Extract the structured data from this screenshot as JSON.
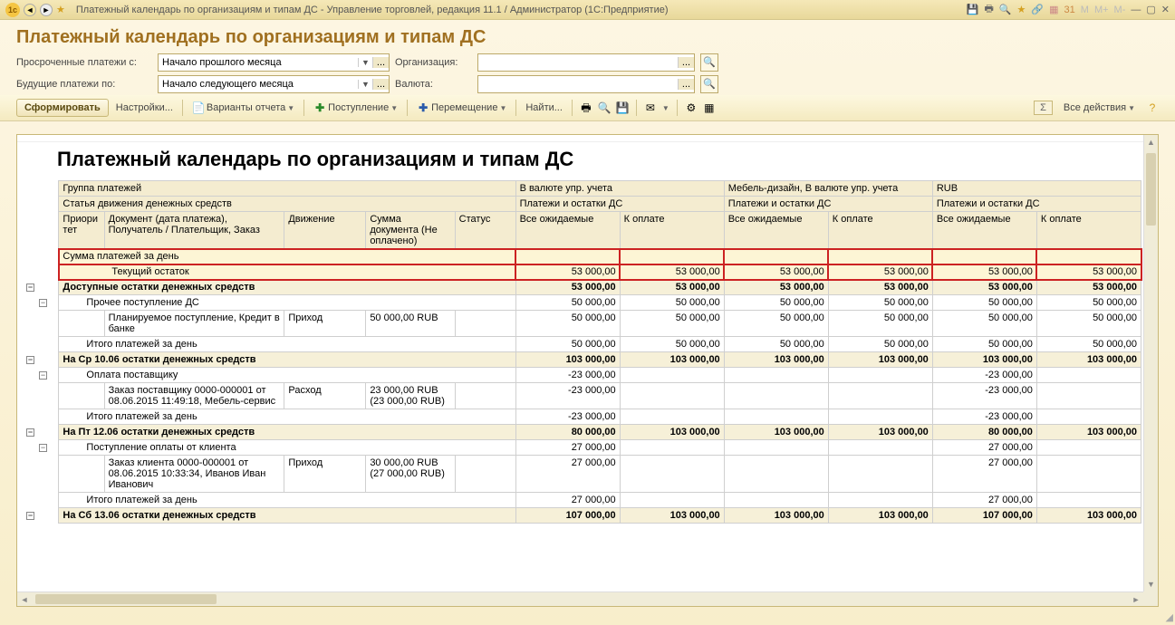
{
  "window": {
    "title": "Платежный календарь по организациям и типам ДС - Управление торговлей, редакция 11.1 / Администратор  (1С:Предприятие)"
  },
  "header": {
    "title": "Платежный календарь по организациям и типам ДС"
  },
  "filters": {
    "overdue_label": "Просроченные платежи с:",
    "overdue_value": "Начало прошлого месяца",
    "org_label": "Организация:",
    "org_value": "",
    "future_label": "Будущие платежи по:",
    "future_value": "Начало следующего месяца",
    "currency_label": "Валюта:",
    "currency_value": ""
  },
  "toolbar": {
    "generate": "Сформировать",
    "settings": "Настройки...",
    "variants": "Варианты отчета",
    "inflow": "Поступление",
    "transfer": "Перемещение",
    "find": "Найти...",
    "all_actions": "Все действия"
  },
  "report": {
    "title": "Платежный календарь по организациям и типам ДС",
    "cols": {
      "group": "Группа платежей",
      "currency_mgmt": "В валюте упр. учета",
      "company_curr": "Мебель-дизайн, В валюте упр. учета",
      "rub": "RUB",
      "article": "Статья движения денежных средств",
      "payments_balances": "Платежи и остатки ДС",
      "priority": "Приори тет",
      "doc": "Документ (дата платежа), Получатель / Плательщик, Заказ",
      "movement": "Движение",
      "sum": "Сумма документа (Не оплачено)",
      "status": "Статус",
      "all_expected": "Все ожидаемые",
      "to_pay": "К оплате"
    },
    "rows": {
      "r0": {
        "label": "Сумма платежей за день"
      },
      "r1": {
        "label": "Текущий остаток",
        "c1": "53 000,00",
        "c2": "53 000,00",
        "c3": "53 000,00",
        "c4": "53 000,00",
        "c5": "53 000,00",
        "c6": "53 000,00"
      },
      "r2": {
        "label": "Доступные остатки денежных средств",
        "c1": "53 000,00",
        "c2": "53 000,00",
        "c3": "53 000,00",
        "c4": "53 000,00",
        "c5": "53 000,00",
        "c6": "53 000,00"
      },
      "r3": {
        "label": "Прочее поступление ДС",
        "c1": "50 000,00",
        "c2": "50 000,00",
        "c3": "50 000,00",
        "c4": "50 000,00",
        "c5": "50 000,00",
        "c6": "50 000,00"
      },
      "r4": {
        "label": "Планируемое поступление, Кредит в банке",
        "mov": "Приход",
        "sum": "50 000,00 RUB",
        "c1": "50 000,00",
        "c2": "50 000,00",
        "c3": "50 000,00",
        "c4": "50 000,00",
        "c5": "50 000,00",
        "c6": "50 000,00"
      },
      "r5": {
        "label": "Итого платежей за день",
        "c1": "50 000,00",
        "c2": "50 000,00",
        "c3": "50 000,00",
        "c4": "50 000,00",
        "c5": "50 000,00",
        "c6": "50 000,00"
      },
      "r6": {
        "label": "На Ср 10.06 остатки денежных средств",
        "c1": "103 000,00",
        "c2": "103 000,00",
        "c3": "103 000,00",
        "c4": "103 000,00",
        "c5": "103 000,00",
        "c6": "103 000,00"
      },
      "r7": {
        "label": "Оплата поставщику",
        "c1": "-23 000,00",
        "c5": "-23 000,00"
      },
      "r8": {
        "label": "Заказ поставщику 0000-000001 от 08.06.2015 11:49:18, Мебель-сервис",
        "mov": "Расход",
        "sum": "23 000,00 RUB (23 000,00 RUB)",
        "c1": "-23 000,00",
        "c5": "-23 000,00"
      },
      "r9": {
        "label": "Итого платежей за день",
        "c1": "-23 000,00",
        "c5": "-23 000,00"
      },
      "r10": {
        "label": "На Пт 12.06 остатки денежных средств",
        "c1": "80 000,00",
        "c2": "103 000,00",
        "c3": "103 000,00",
        "c4": "103 000,00",
        "c5": "80 000,00",
        "c6": "103 000,00"
      },
      "r11": {
        "label": "Поступление оплаты от клиента",
        "c1": "27 000,00",
        "c5": "27 000,00"
      },
      "r12": {
        "label": "Заказ клиента 0000-000001 от 08.06.2015 10:33:34, Иванов Иван Иванович",
        "mov": "Приход",
        "sum": "30 000,00 RUB (27 000,00 RUB)",
        "c1": "27 000,00",
        "c5": "27 000,00"
      },
      "r13": {
        "label": "Итого платежей за день",
        "c1": "27 000,00",
        "c5": "27 000,00"
      },
      "r14": {
        "label": "На Сб 13.06 остатки денежных средств",
        "c1": "107 000,00",
        "c2": "103 000,00",
        "c3": "103 000,00",
        "c4": "103 000,00",
        "c5": "107 000,00",
        "c6": "103 000,00"
      }
    }
  }
}
